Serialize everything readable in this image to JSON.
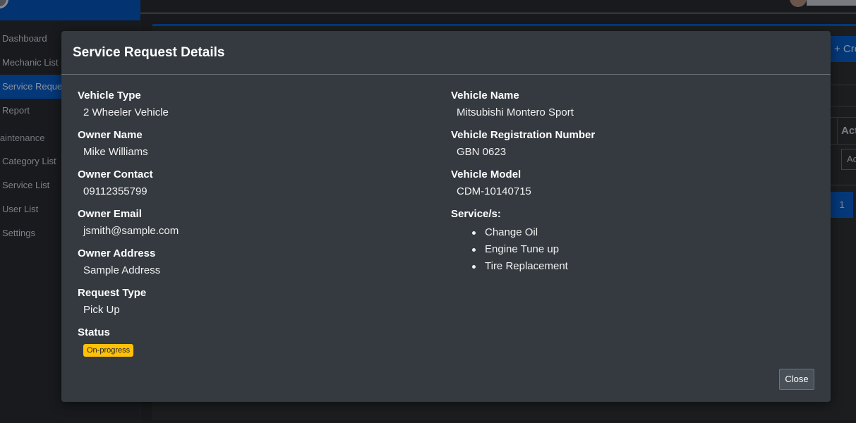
{
  "sidebar": {
    "items": [
      {
        "label": "Dashboard",
        "active": false
      },
      {
        "label": "Mechanic List",
        "active": false
      },
      {
        "label": "Service Requests",
        "active": true
      },
      {
        "label": "Report",
        "active": false
      }
    ],
    "section_header": "Maintenance",
    "maintenance_items": [
      {
        "label": "Category List"
      },
      {
        "label": "Service List"
      },
      {
        "label": "User List"
      },
      {
        "label": "Settings"
      }
    ]
  },
  "background": {
    "create_button_label": "+ Create New",
    "table_action_header": "Action",
    "row_action_button": "Action",
    "pagination_current": "1"
  },
  "modal": {
    "title": "Service Request Details",
    "left_fields": [
      {
        "label": "Vehicle Type",
        "value": "2 Wheeler Vehicle"
      },
      {
        "label": "Owner Name",
        "value": "Mike Williams"
      },
      {
        "label": "Owner Contact",
        "value": "09112355799"
      },
      {
        "label": "Owner Email",
        "value": "jsmith@sample.com"
      },
      {
        "label": "Owner Address",
        "value": "Sample Address"
      },
      {
        "label": "Request Type",
        "value": "Pick Up"
      }
    ],
    "status": {
      "label": "Status",
      "value": "On-progress",
      "color": "#ffc107"
    },
    "right_fields": [
      {
        "label": "Vehicle Name",
        "value": "Mitsubishi Montero Sport"
      },
      {
        "label": "Vehicle Registration Number",
        "value": "GBN 0623"
      },
      {
        "label": "Vehicle Model",
        "value": "CDM-10140715"
      }
    ],
    "services_label": "Service/s:",
    "services": [
      "Change Oil",
      "Engine Tune up",
      "Tire Replacement"
    ],
    "close_label": "Close"
  },
  "colors": {
    "primary": "#05408a",
    "modal_bg": "#343a40",
    "badge_warning": "#ffc107"
  }
}
